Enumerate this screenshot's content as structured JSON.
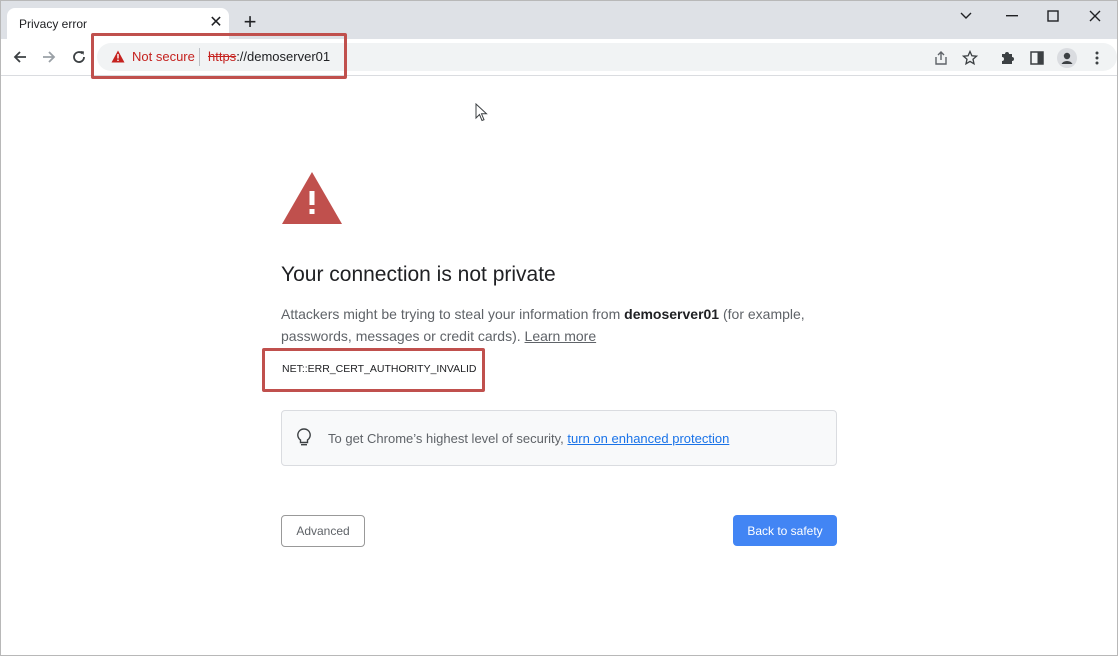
{
  "tab": {
    "title": "Privacy error",
    "close_icon": "close-icon",
    "new_tab_icon": "plus-icon"
  },
  "window_controls": [
    "chevron-down-icon",
    "minimize-icon",
    "maximize-icon",
    "close-icon"
  ],
  "toolbar": {
    "icons": [
      "back-arrow-icon",
      "forward-arrow-icon",
      "reload-icon"
    ],
    "security_label": "Not secure",
    "url_scheme": "https",
    "url_rest": "://demoserver01",
    "right_icons": [
      "share-icon",
      "star-icon",
      "extensions-icon",
      "side-panel-icon",
      "profile-icon",
      "more-icon"
    ]
  },
  "content": {
    "heading": "Your connection is not private",
    "para_before": "Attackers might be trying to steal your information from ",
    "para_host": "demoserver01",
    "para_after": " (for example, passwords, messages or credit cards). ",
    "learn_more": "Learn more",
    "error_code": "NET::ERR_CERT_AUTHORITY_INVALID",
    "tip_text": "To get Chrome’s highest level of security, ",
    "tip_link": "turn on enhanced protection",
    "advanced_label": "Advanced",
    "back_label": "Back to safety"
  },
  "colors": {
    "warning": "#c0504d",
    "highlight_box": "#c0504d",
    "primary_button": "#4285f4",
    "link": "#1a73e8"
  }
}
